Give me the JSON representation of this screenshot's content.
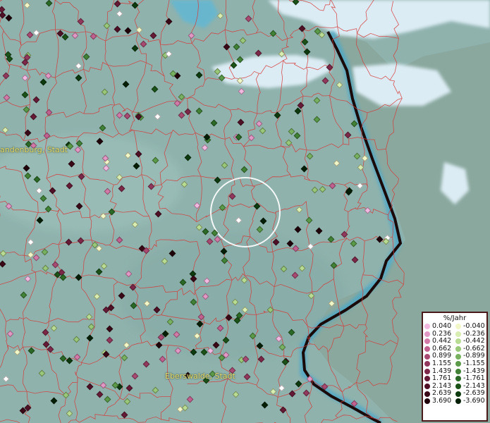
{
  "map": {
    "places": [
      {
        "label": "andenburg, Stadt",
        "pos": "left-middle"
      },
      {
        "label": "Eberswalde, Stadt",
        "pos": "bottom-center"
      }
    ],
    "legend": {
      "title": "%/Jahr",
      "positive": [
        {
          "value": "0.040",
          "color": "#f2b8e0"
        },
        {
          "value": "0.236",
          "color": "#e297c4"
        },
        {
          "value": "0.442",
          "color": "#d37aa8"
        },
        {
          "value": "0.662",
          "color": "#c26190"
        },
        {
          "value": "0.899",
          "color": "#a94a73"
        },
        {
          "value": "1.155",
          "color": "#93385d"
        },
        {
          "value": "1.439",
          "color": "#7d2848"
        },
        {
          "value": "1.761",
          "color": "#661a35"
        },
        {
          "value": "2.143",
          "color": "#501025"
        },
        {
          "value": "2.639",
          "color": "#3a0816"
        },
        {
          "value": "3.690",
          "color": "#20030a"
        }
      ],
      "negative": [
        {
          "value": "-0.040",
          "color": "#f2f7c8"
        },
        {
          "value": "-0.236",
          "color": "#d8edb0"
        },
        {
          "value": "-0.442",
          "color": "#b8dc92"
        },
        {
          "value": "-0.662",
          "color": "#98c878"
        },
        {
          "value": "-0.899",
          "color": "#78b260"
        },
        {
          "value": "-1.155",
          "color": "#5a9a48"
        },
        {
          "value": "-1.439",
          "color": "#418236"
        },
        {
          "value": "-1.761",
          "color": "#2b6a26"
        },
        {
          "value": "-2.143",
          "color": "#1a5218"
        },
        {
          "value": "-2.639",
          "color": "#0d3a0e"
        },
        {
          "value": "-3.690",
          "color": "#041f06"
        }
      ]
    },
    "colors": {
      "land": "#8fb2ad",
      "border_lines": "#d63a3a",
      "water": "#3fa7cf",
      "sea_ice": "#dcecf4",
      "country_border": "#1a0a0a",
      "selection_circle": "#ffffff"
    }
  }
}
